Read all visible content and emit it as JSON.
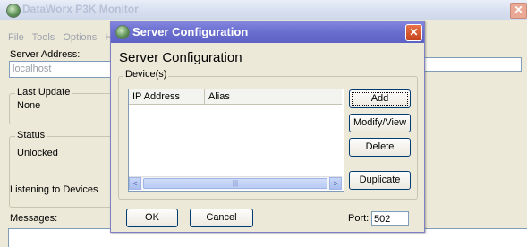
{
  "main_window": {
    "title": "DataWorx P3K Monitor",
    "close_glyph": "✕",
    "menu": [
      "File",
      "Tools",
      "Options",
      "Hel"
    ],
    "server_address_label": "Server Address:",
    "server_address_value": "localhost",
    "last_update_title": "Last Update",
    "last_update_value": "None",
    "status_title": "Status",
    "status_value": "Unlocked",
    "listening_text": "Listening to Devices",
    "messages_label": "Messages:"
  },
  "dialog": {
    "title": "Server Configuration",
    "close_glyph": "✕",
    "heading": "Server Configuration",
    "devices_legend": "Device(s)",
    "columns": [
      "IP Address",
      "Alias"
    ],
    "scroll_left_glyph": "<",
    "scroll_right_glyph": ">",
    "scroll_thumb_glyph": "|||",
    "buttons": {
      "add": "Add",
      "modify_view": "Modify/View",
      "delete": "Delete",
      "duplicate": "Duplicate",
      "ok": "OK",
      "cancel": "Cancel"
    },
    "port_label": "Port:",
    "port_value": "502"
  },
  "colors": {
    "dialog_title_bar": "#6b6fcf",
    "close_button": "#c4431c",
    "window_face": "#ece9d8"
  }
}
